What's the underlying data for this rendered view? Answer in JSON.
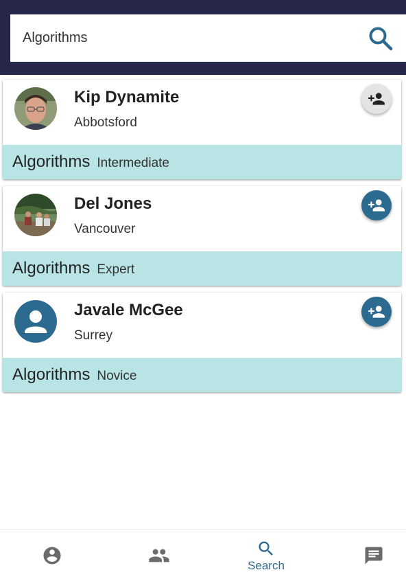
{
  "search": {
    "value": "Algorithms",
    "icon": "search-icon"
  },
  "results": [
    {
      "name": "Kip Dynamite",
      "city": "Abbotsford",
      "skill": "Algorithms",
      "level": "Intermediate",
      "avatar": "photo-man-glasses",
      "add_button_style": "grey"
    },
    {
      "name": "Del Jones",
      "city": "Vancouver",
      "skill": "Algorithms",
      "level": "Expert",
      "avatar": "photo-group-outdoors",
      "add_button_style": "blue"
    },
    {
      "name": "Javale McGee",
      "city": "Surrey",
      "skill": "Algorithms",
      "level": "Novice",
      "avatar": "default-person-icon",
      "add_button_style": "blue"
    }
  ],
  "bottom_nav": {
    "items": [
      {
        "id": "profile",
        "icon": "account-circle-icon"
      },
      {
        "id": "friends",
        "icon": "people-icon"
      },
      {
        "id": "search",
        "icon": "search-icon",
        "label": "Search",
        "active": true
      },
      {
        "id": "messages",
        "icon": "chat-icon"
      }
    ]
  },
  "colors": {
    "header": "#26254a",
    "accent": "#2d6a8f",
    "skill_band": "#b9e4e6",
    "inactive_icon": "#6b6b6b"
  }
}
